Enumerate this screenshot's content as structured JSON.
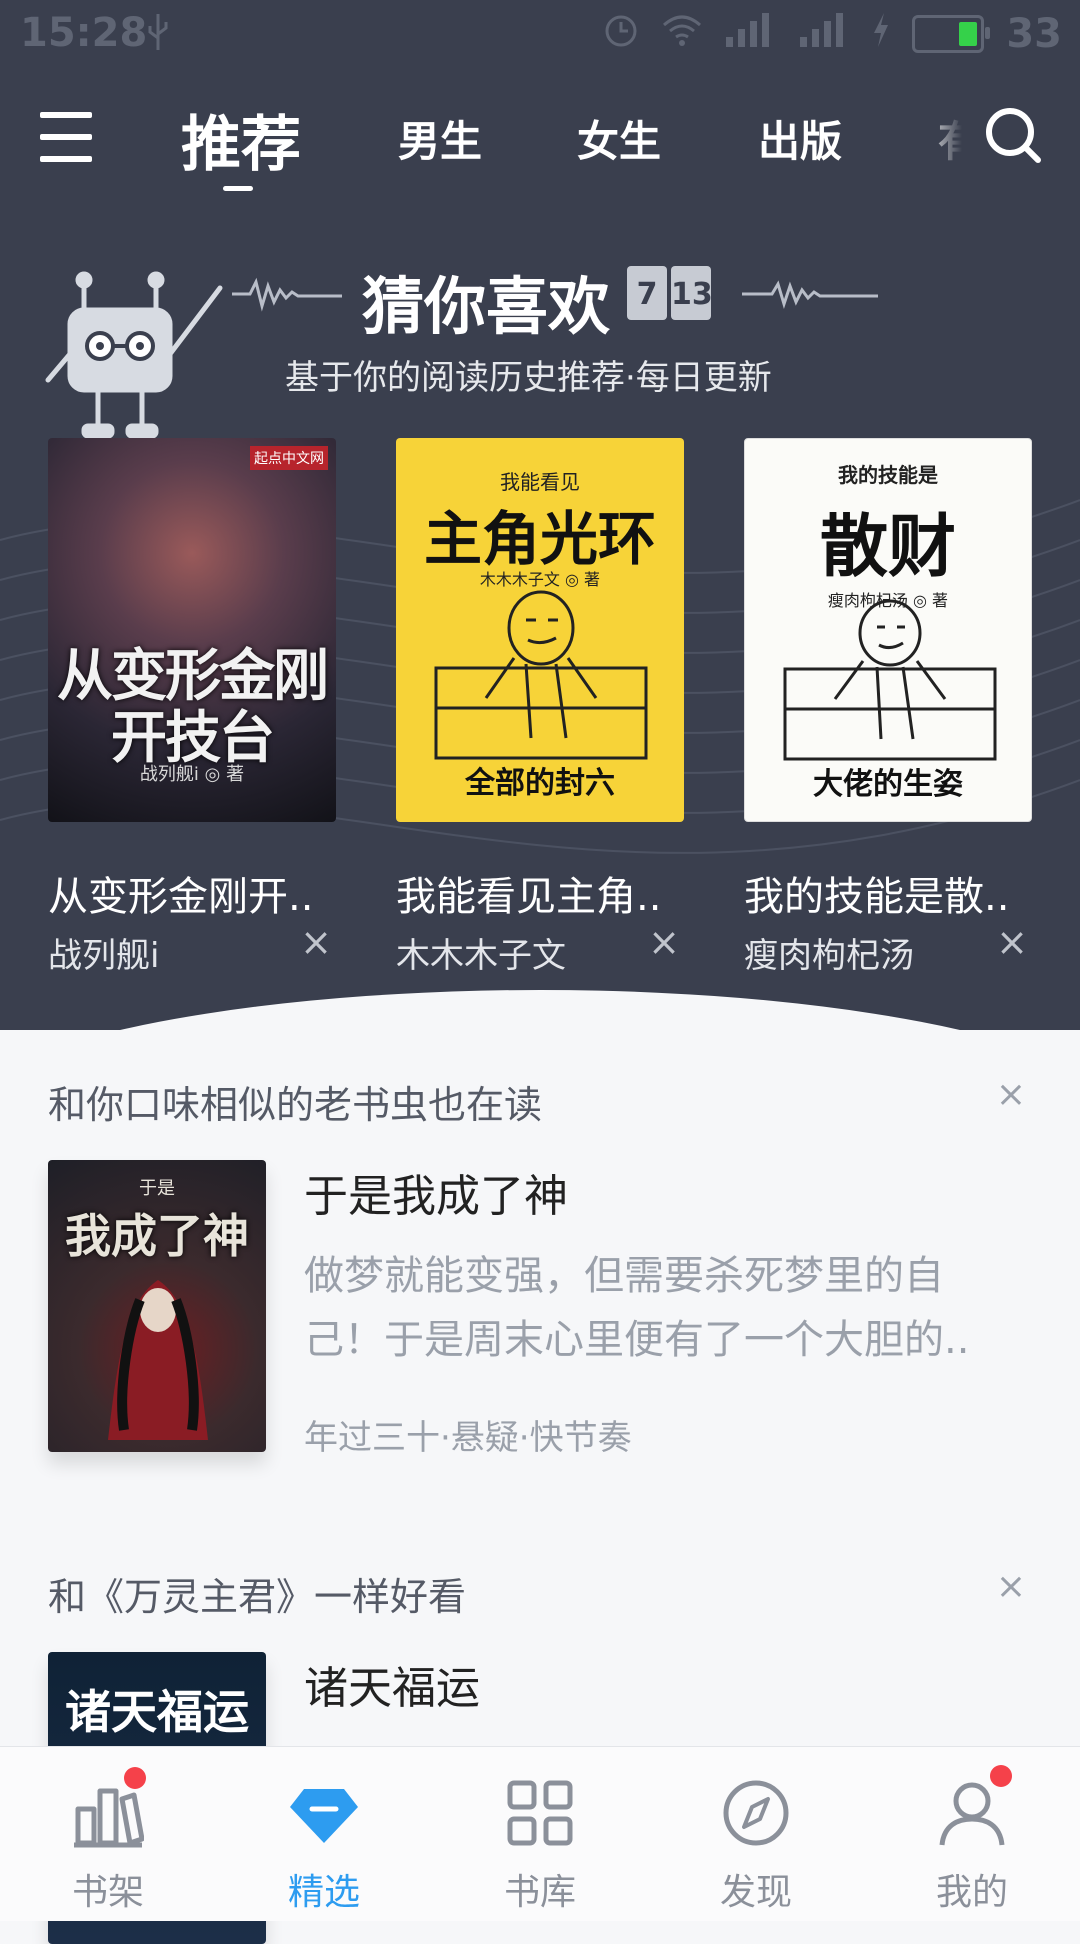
{
  "status_bar": {
    "time": "15:28",
    "network": "4G",
    "battery": "33"
  },
  "nav": {
    "tabs": [
      {
        "label": "推荐",
        "active": true
      },
      {
        "label": "男生"
      },
      {
        "label": "女生"
      },
      {
        "label": "出版"
      },
      {
        "label": "有"
      }
    ]
  },
  "guess": {
    "title": "猜你喜欢",
    "date": [
      "7",
      "13"
    ],
    "subtitle": "基于你的阅读历史推荐·每日更新",
    "books": [
      {
        "title": "从变形金刚开..",
        "author": "战列舰i",
        "cover_title": "从变形金刚开技台",
        "cover_author": "战列舰i ◎ 著",
        "cover_publisher": "起点中文网"
      },
      {
        "title": "我能看见主角..",
        "author": "木木木子文",
        "cover_small": "我能看见",
        "cover_title": "主角光环",
        "cover_author": "木木木子文 ◎ 著",
        "cover_foot": "全部的封六"
      },
      {
        "title": "我的技能是散..",
        "author": "瘦肉枸杞汤",
        "cover_small": "我的技能是",
        "cover_title": "散财",
        "cover_author": "瘦肉枸杞汤 ◎ 著",
        "cover_foot": "大佬的生姿"
      }
    ],
    "close_glyph": "×"
  },
  "similar": {
    "header": "和你口味相似的老书虫也在读",
    "close_glyph": "×",
    "book": {
      "title": "于是我成了神",
      "cover_title": "我成了神",
      "cover_small": "于是",
      "desc_line1": "做梦就能变强，但需要杀死梦里的自",
      "desc_line2": "己！于是周末心里便有了一个大胆的..",
      "tags": "年过三十·悬疑·快节奏"
    }
  },
  "like": {
    "header": "和《万灵主君》一样好看",
    "close_glyph": "×",
    "book": {
      "title": "诸天福运",
      "cover_title": "诸天福运"
    }
  },
  "bottom_nav": {
    "items": [
      {
        "label": "书架"
      },
      {
        "label": "精选"
      },
      {
        "label": "书库"
      },
      {
        "label": "发现"
      },
      {
        "label": "我的"
      }
    ],
    "accent": "#2d9cf0"
  }
}
